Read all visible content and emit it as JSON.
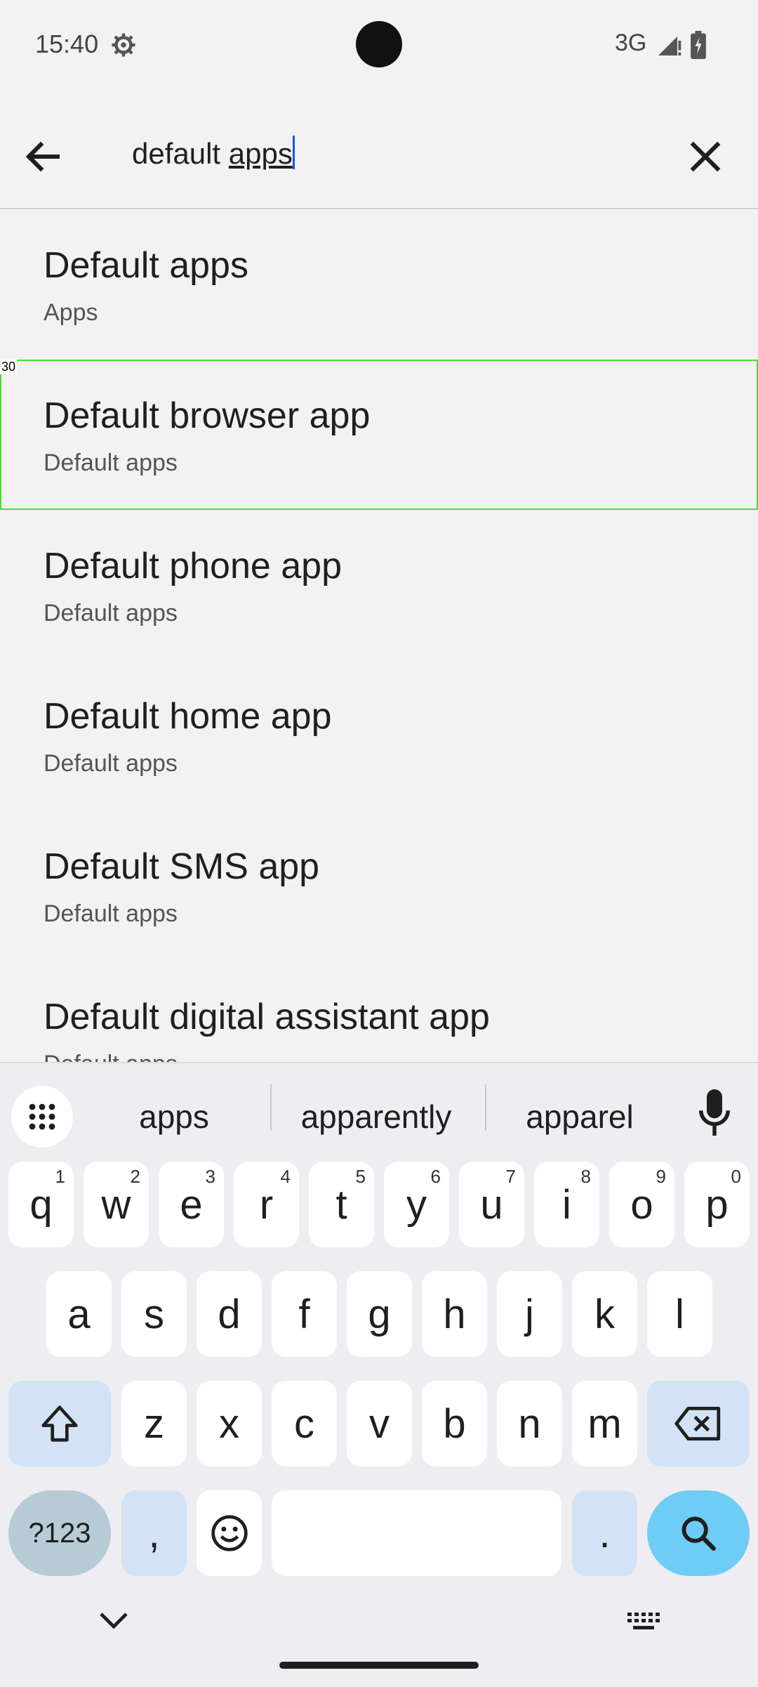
{
  "status_bar": {
    "time": "15:40",
    "network": "3G"
  },
  "search": {
    "query_plain": "default ",
    "query_underlined": "apps"
  },
  "results": [
    {
      "title": "Default apps",
      "subtitle": "Apps"
    },
    {
      "title": "Default browser app",
      "subtitle": "Default apps",
      "marker": "30"
    },
    {
      "title": "Default phone app",
      "subtitle": "Default apps"
    },
    {
      "title": "Default home app",
      "subtitle": "Default apps"
    },
    {
      "title": "Default SMS app",
      "subtitle": "Default apps"
    },
    {
      "title": "Default digital assistant app",
      "subtitle": "Default apps"
    }
  ],
  "keyboard": {
    "suggestions": [
      "apps",
      "apparently",
      "apparel"
    ],
    "row1": [
      {
        "k": "q",
        "h": "1"
      },
      {
        "k": "w",
        "h": "2"
      },
      {
        "k": "e",
        "h": "3"
      },
      {
        "k": "r",
        "h": "4"
      },
      {
        "k": "t",
        "h": "5"
      },
      {
        "k": "y",
        "h": "6"
      },
      {
        "k": "u",
        "h": "7"
      },
      {
        "k": "i",
        "h": "8"
      },
      {
        "k": "o",
        "h": "9"
      },
      {
        "k": "p",
        "h": "0"
      }
    ],
    "row2": [
      "a",
      "s",
      "d",
      "f",
      "g",
      "h",
      "j",
      "k",
      "l"
    ],
    "row3": [
      "z",
      "x",
      "c",
      "v",
      "b",
      "n",
      "m"
    ],
    "sym_label": "?123",
    "comma": ",",
    "period": "."
  }
}
